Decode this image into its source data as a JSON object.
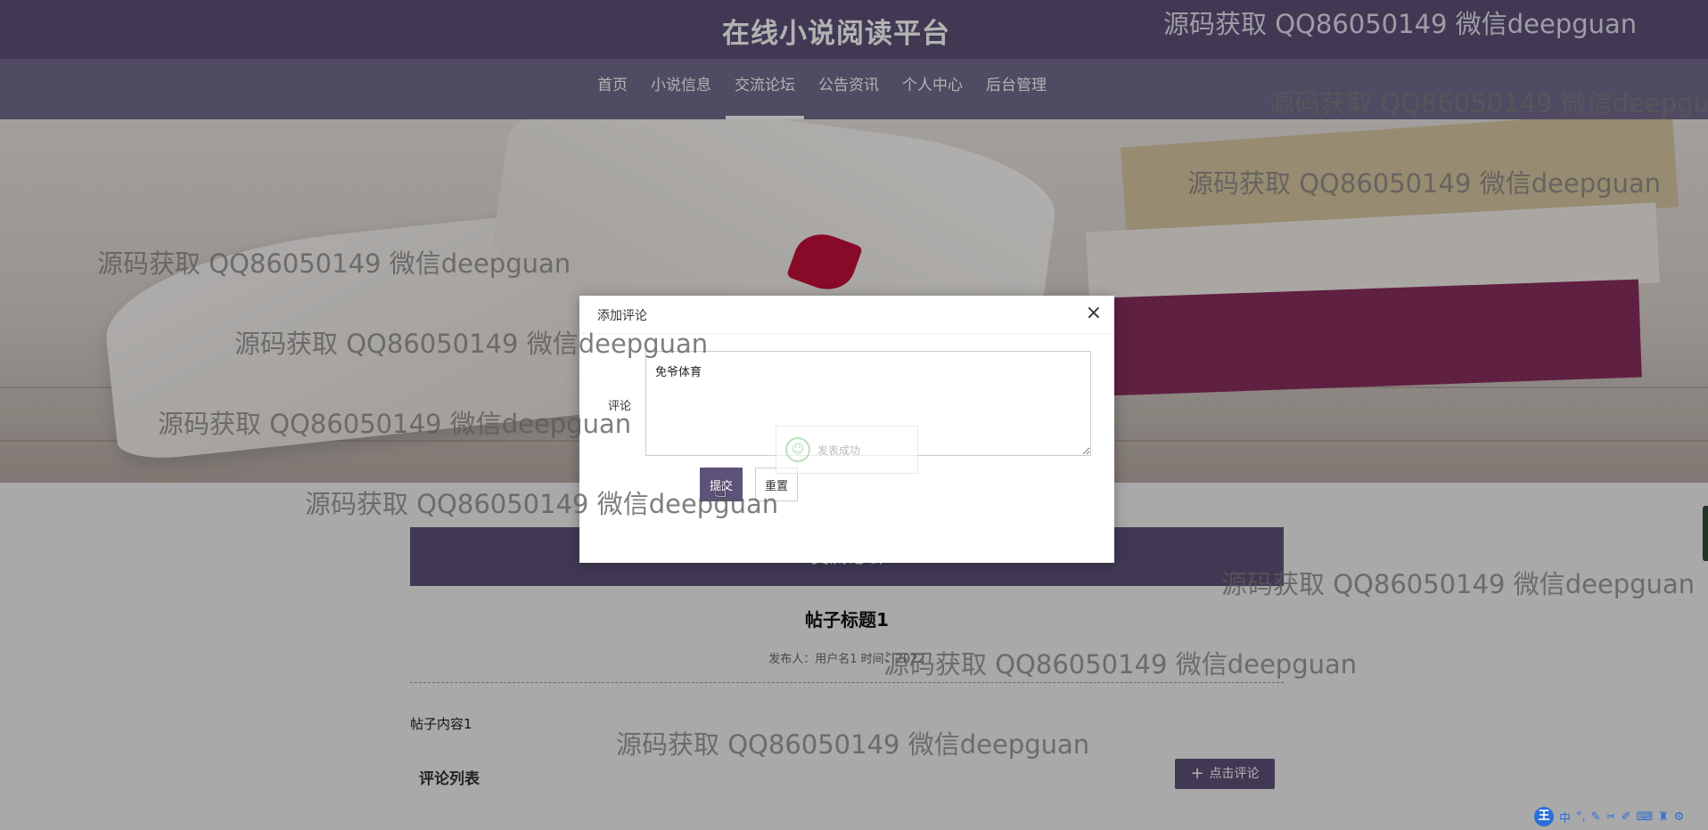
{
  "header": {
    "title": "在线小说阅读平台"
  },
  "nav": {
    "items": [
      "首页",
      "小说信息",
      "交流论坛",
      "公告资讯",
      "个人中心",
      "后台管理"
    ],
    "active": "交流论坛"
  },
  "forum": {
    "bar_title": "交流论坛",
    "post_title": "帖子标题1",
    "post_meta": "发布人：用户名1 时间：2022",
    "post_content": "帖子内容1",
    "comments_heading": "评论列表",
    "comment_button": "点击评论"
  },
  "modal": {
    "title": "添加评论",
    "close": "×",
    "field_label": "评论",
    "textarea_value": "免爷体育",
    "submit": "提交",
    "reset": "重置",
    "toast": "发表成功"
  },
  "watermark": "源码获取 QQ86050149 微信deepguan",
  "ime": {
    "logo": "王",
    "lang": "中"
  },
  "colors": {
    "primary": "#5d5279",
    "nav_bg": "#736a8d"
  }
}
